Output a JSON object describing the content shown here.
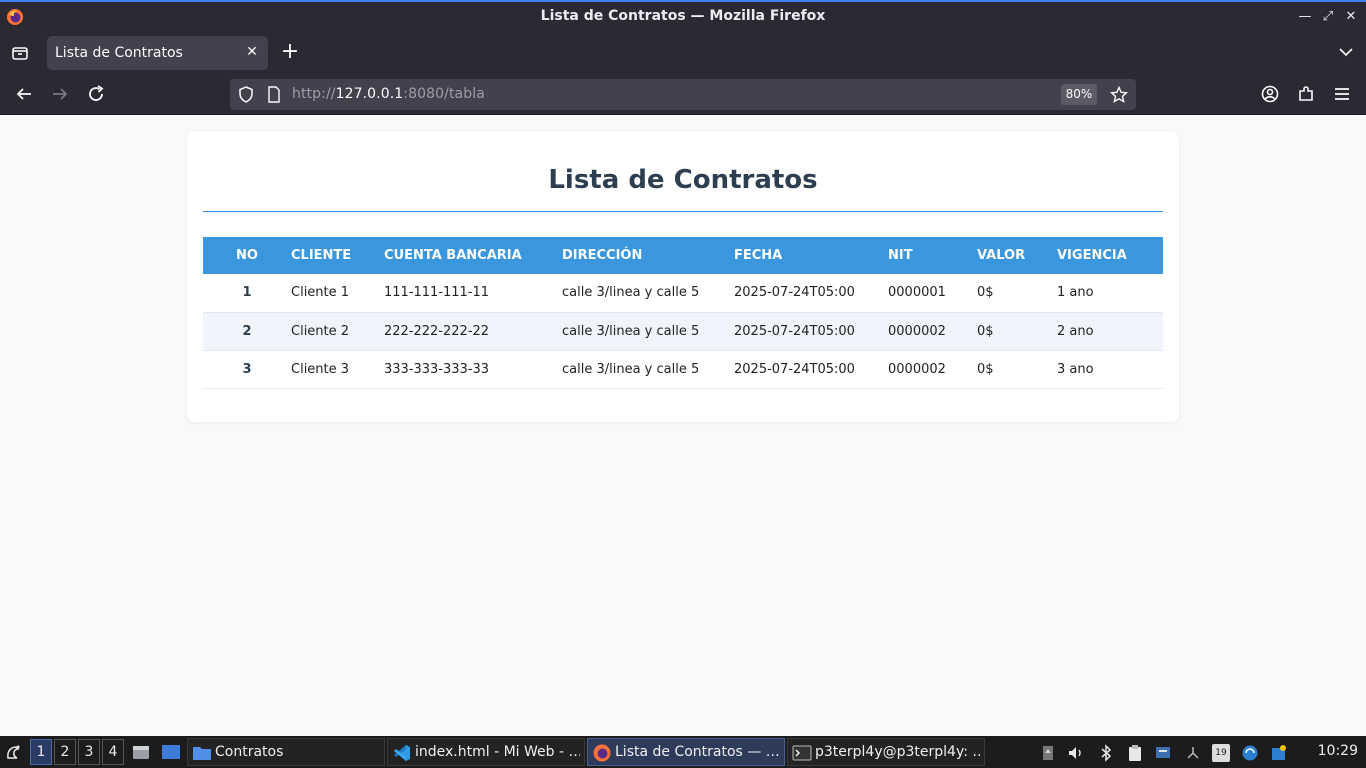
{
  "window": {
    "title": "Lista de Contratos — Mozilla Firefox"
  },
  "tabs": [
    {
      "label": "Lista de Contratos",
      "active": true
    }
  ],
  "navbar": {
    "url_scheme": "http://",
    "url_host": "127.0.0.1",
    "url_rest": ":8080/tabla",
    "zoom": "80%"
  },
  "page": {
    "heading": "Lista de Contratos",
    "accent_color": "#3a97de",
    "table": {
      "headers": [
        "NO",
        "CLIENTE",
        "CUENTA BANCARIA",
        "DIRECCIÓN",
        "FECHA",
        "NIT",
        "VALOR",
        "VIGENCIA"
      ],
      "rows": [
        [
          "1",
          "Cliente 1",
          "111-111-111-11",
          "calle 3/linea y calle 5",
          "2025-07-24T05:00",
          "0000001",
          "0$",
          "1 ano"
        ],
        [
          "2",
          "Cliente 2",
          "222-222-222-22",
          "calle 3/linea y calle 5",
          "2025-07-24T05:00",
          "0000002",
          "0$",
          "2 ano"
        ],
        [
          "3",
          "Cliente 3",
          "333-333-333-33",
          "calle 3/linea y calle 5",
          "2025-07-24T05:00",
          "0000002",
          "0$",
          "3 ano"
        ]
      ]
    }
  },
  "taskbar": {
    "workspaces": [
      "1",
      "2",
      "3",
      "4"
    ],
    "active_workspace": "1",
    "tasks": [
      {
        "label": "Contratos",
        "icon": "folder-icon"
      },
      {
        "label": "index.html - Mi Web - …",
        "icon": "vscode-icon"
      },
      {
        "label": "Lista de Contratos — …",
        "icon": "firefox-icon",
        "active": true
      },
      {
        "label": "p3terpl4y@p3terpl4y: …",
        "icon": "terminal-icon"
      }
    ],
    "clock": "10:29",
    "tray_badge": "19"
  }
}
